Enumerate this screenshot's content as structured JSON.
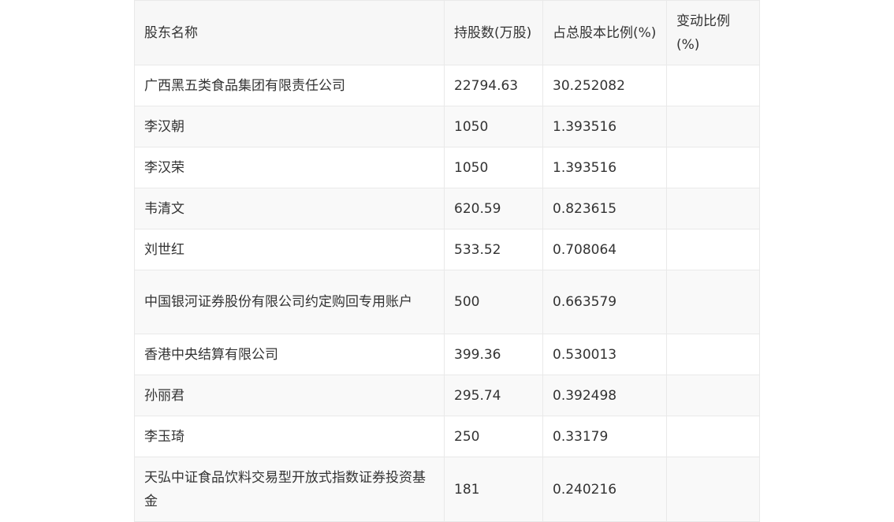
{
  "table": {
    "headers": [
      "股东名称",
      "持股数(万股)",
      "占总股本比例(%)",
      "变动比例(%)"
    ],
    "rows": [
      {
        "name": "广西黑五类食品集团有限责任公司",
        "shares": "22794.63",
        "ratio": "30.252082",
        "change": ""
      },
      {
        "name": "李汉朝",
        "shares": "1050",
        "ratio": "1.393516",
        "change": ""
      },
      {
        "name": "李汉荣",
        "shares": "1050",
        "ratio": "1.393516",
        "change": ""
      },
      {
        "name": "韦清文",
        "shares": "620.59",
        "ratio": "0.823615",
        "change": ""
      },
      {
        "name": "刘世红",
        "shares": "533.52",
        "ratio": "0.708064",
        "change": ""
      },
      {
        "name": "中国银河证券股份有限公司约定购回专用账户",
        "shares": "500",
        "ratio": "0.663579",
        "change": ""
      },
      {
        "name": "香港中央结算有限公司",
        "shares": "399.36",
        "ratio": "0.530013",
        "change": ""
      },
      {
        "name": "孙丽君",
        "shares": "295.74",
        "ratio": "0.392498",
        "change": ""
      },
      {
        "name": "李玉琦",
        "shares": "250",
        "ratio": "0.33179",
        "change": ""
      },
      {
        "name": "天弘中证食品饮料交易型开放式指数证券投资基金",
        "shares": "181",
        "ratio": "0.240216",
        "change": ""
      }
    ]
  }
}
